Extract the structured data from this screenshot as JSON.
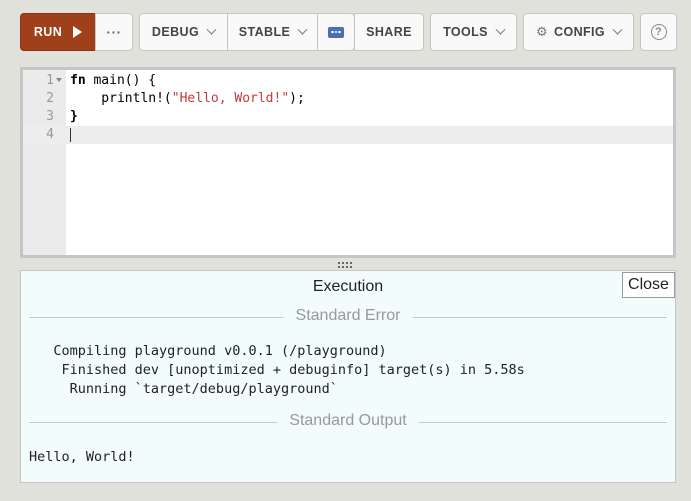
{
  "toolbar": {
    "run_label": "RUN",
    "more_label": "···",
    "mode_label": "DEBUG",
    "channel_label": "STABLE",
    "share_label": "SHARE",
    "tools_label": "TOOLS",
    "config_label": "CONFIG",
    "help_label": "?",
    "icons": {
      "run": "play-icon",
      "config": "gear-icon",
      "help": "question-circle-icon",
      "edition": "edition-icon"
    }
  },
  "editor": {
    "line_numbers": [
      "1",
      "2",
      "3",
      "4"
    ],
    "lines": [
      [
        "fn",
        " main() {"
      ],
      [
        "    println!(",
        "\"Hello, World!\"",
        ");"
      ],
      [
        "}"
      ],
      [
        ""
      ]
    ],
    "active_line": 4
  },
  "output": {
    "title": "Execution",
    "close_label": "Close",
    "stderr_header": "Standard Error",
    "stderr_text": "   Compiling playground v0.0.1 (/playground)\n    Finished dev [unoptimized + debuginfo] target(s) in 5.58s\n     Running `target/debug/playground`",
    "stdout_header": "Standard Output",
    "stdout_text": "Hello, World!"
  },
  "colors": {
    "run_button": "#a0401a",
    "page_bg": "#e1e1db",
    "output_bg": "#f2fcfd",
    "string_literal": "#c23b3b",
    "edition_icon": "#4a6fb5"
  }
}
